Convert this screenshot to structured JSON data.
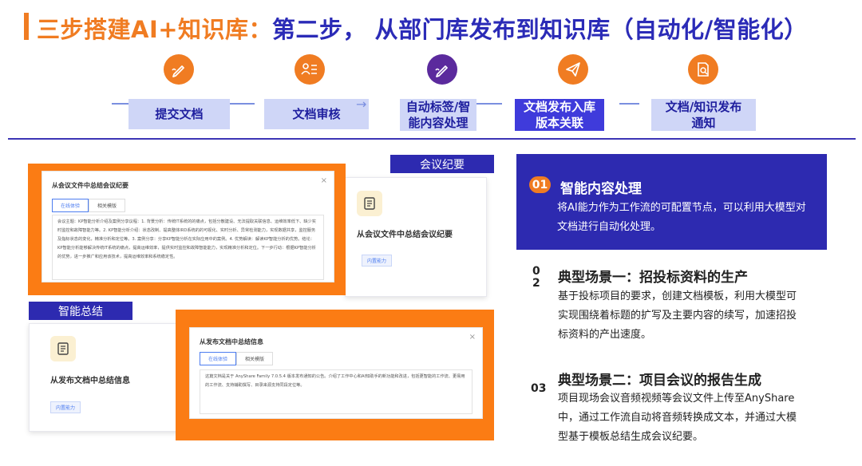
{
  "header": {
    "title_lead": "三步搭建AI+知识库：",
    "title_rest": "第二步， 从部门库发布到知识库（自动化/智能化）"
  },
  "colors": {
    "orange": "#f07c22",
    "indigo": "#2d2ab0",
    "step_fill": "#cfd6f7",
    "step_active": "#3f3bdb"
  },
  "steps": [
    {
      "label": "提交文档",
      "icon": "pen-icon"
    },
    {
      "label": "文档审核",
      "icon": "review-list-icon"
    },
    {
      "label_line1": "自动标签/智",
      "label_line2": "能内容处理",
      "icon": "ai-pen-icon"
    },
    {
      "label_line1": "文档发布入库",
      "label_line2": "版本关联",
      "icon": "paper-plane-icon"
    },
    {
      "label_line1": "文档/知识发布",
      "label_line2": "通知",
      "icon": "document-search-icon"
    }
  ],
  "left": {
    "meeting_label": "会议纪要",
    "summary_label": "智能总结",
    "dialog1": {
      "title": "从会议文件中总结会议纪要",
      "close": "×",
      "tab_on": "在线体验",
      "tab_off": "相关模版",
      "body": "会议主题：KP智能分析介绍及案例分享议程：1. 背景分析：传统IT系统的的痛点，包括分散建设、无法提取关联信息、运维效率低下、缺少实时监控和故障智能力等。2. KP智能分析介绍：状态改制、提高整体IRD系统的的可视化、实时分析、异常检测能力，实现数据共享，监控服务及指标状态的变化，精准分析和定位等。3. 案例分享：分享KP智能分析在实际应用中的案例。4. 优势解读：解读KP智能分析的优势。结论：KP智能分析能够解决传统IT系统的痛点，提高运维效率，提供实时监控和故障智能能力，实现精准分析和定位。下一步行动：根据KP智能分析的优势，进一步推广和应用该技术，提高运维效率和系统稳定性。"
    },
    "card1": {
      "name": "从会议文件中总结会议纪要",
      "tag": "内置能力",
      "icon": "document-icon"
    },
    "dialog2": {
      "title": "从发布文档中总结信息",
      "close": "×",
      "tab_on": "在线体验",
      "tab_off": "相关模版",
      "body": "这篇文档是关于 AnyShare Family 7.0.5.4 版本发布通知的公告。介绍了工作中心和AI知助手的新功能和改进，包括更智能的工作流、更易用的工作流、支持辅助撰写、目录来源支持同段定位等。"
    },
    "card2": {
      "name": "从发布文档中总结信息",
      "tag": "内置能力",
      "icon": "document-icon"
    }
  },
  "right": {
    "item1": {
      "num": "01",
      "title": "智能内容处理",
      "text": "将AI能力作为工作流的可配置节点，可以利用大模型对文档进行自动化处理。"
    },
    "item2": {
      "num_top": "0",
      "num_bottom": "2",
      "title": "典型场景一：招投标资料的生产",
      "text": "基于投标项目的要求，创建文档模板，利用大模型可实现围绕着标题的扩写及主要内容的续写，加速招投标资料的产出速度。"
    },
    "item3": {
      "num": "03",
      "title": "典型场景二：项目会议的报告生成",
      "text": "项目现场会议音频视频等会议文件上传至AnyShare中，通过工作流自动将音频转换成文本，并通过大模型基于模板总结生成会议纪要。"
    }
  }
}
